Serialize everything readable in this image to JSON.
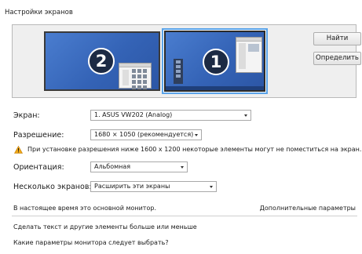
{
  "window": {
    "title": "Настройки экранов"
  },
  "preview": {
    "monitor_2_number": "2",
    "monitor_1_number": "1",
    "buttons": {
      "find": "Найти",
      "identify": "Определить"
    }
  },
  "form": {
    "display": {
      "label": "Экран:",
      "value": "1. ASUS VW202 (Analog)"
    },
    "resolution": {
      "label": "Разрешение:",
      "value": "1680 × 1050 (рекомендуется)"
    },
    "warning": "При установке разрешения ниже 1600 x 1200 некоторые элементы могут не поместиться на экран.",
    "orientation": {
      "label": "Ориентация:",
      "value": "Альбомная"
    },
    "multiple_displays": {
      "label": "Несколько экранов:",
      "value": "Расширить эти экраны"
    }
  },
  "status": {
    "main_monitor_text": "В настоящее время это основной монитор.",
    "advanced_link": "Дополнительные параметры"
  },
  "links": {
    "text_size": "Сделать текст и другие элементы больше или меньше",
    "which_settings": "Какие параметры монитора следует выбрать?"
  },
  "colors": {
    "desktop_blue": "#3463b6",
    "selection_border": "#5aa3e8",
    "warning_yellow": "#f0a818"
  }
}
